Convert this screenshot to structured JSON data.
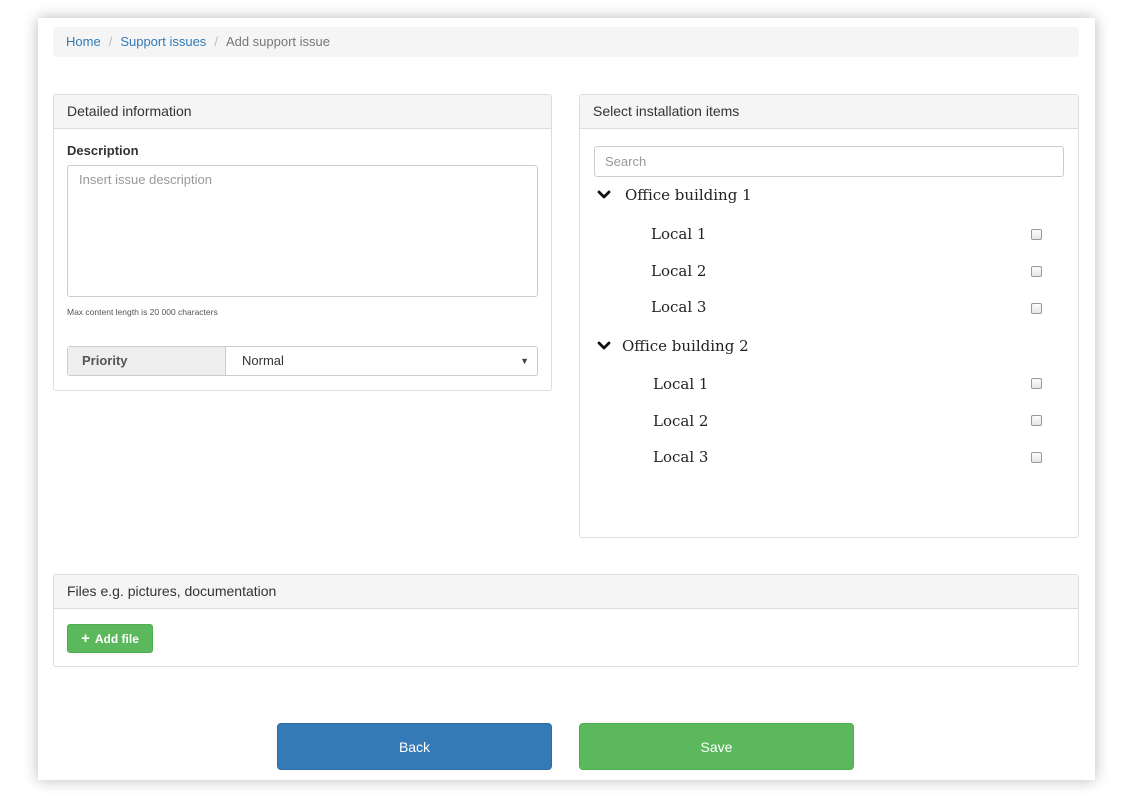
{
  "breadcrumb": {
    "home": "Home",
    "support_issues": "Support issues",
    "current": "Add support issue"
  },
  "detail_panel": {
    "title": "Detailed information",
    "description_label": "Description",
    "description_placeholder": "Insert issue description",
    "description_value": "",
    "hint": "Max content length is 20 000 characters",
    "priority_label": "Priority",
    "priority_value": "Normal"
  },
  "install_panel": {
    "title": "Select installation items",
    "search_placeholder": "Search",
    "buildings": [
      {
        "name": "Office building 1",
        "expanded": true,
        "locals": [
          {
            "label": "Local 1",
            "checked": false
          },
          {
            "label": "Local 2",
            "checked": false
          },
          {
            "label": "Local 3",
            "checked": false
          }
        ]
      },
      {
        "name": "Office building 2",
        "expanded": true,
        "locals": [
          {
            "label": "Local 1",
            "checked": false
          },
          {
            "label": "Local 2",
            "checked": false
          },
          {
            "label": "Local 3",
            "checked": false
          }
        ]
      }
    ]
  },
  "files_panel": {
    "title": "Files e.g. pictures, documentation",
    "add_file_label": "Add file"
  },
  "actions": {
    "back_label": "Back",
    "save_label": "Save"
  },
  "colors": {
    "link": "#337ab7",
    "primary": "#337ab7",
    "success": "#5cb85c",
    "panel_heading_bg": "#f5f5f5"
  }
}
